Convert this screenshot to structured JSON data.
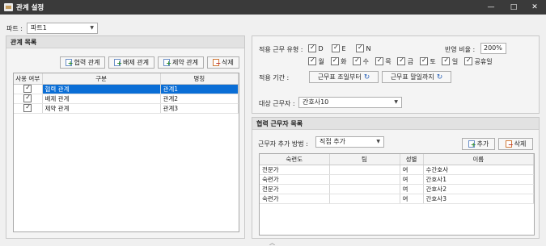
{
  "window": {
    "title": "관계 설정",
    "icon": "app-icon",
    "controls": [
      "minimize-icon",
      "maximize-icon",
      "close-icon"
    ]
  },
  "part": {
    "label": "파트 :",
    "selected": "파트1"
  },
  "relation_panel": {
    "title": "관계 목록",
    "buttons": {
      "cooperate": "협력 관계",
      "exclude": "배제 관계",
      "restrict": "제약 관계",
      "delete": "삭제"
    },
    "columns": [
      "사용 여부",
      "구분",
      "명칭"
    ],
    "rows": [
      {
        "checked": true,
        "kind": "협력 관계",
        "name": "관계1",
        "selected": true
      },
      {
        "checked": true,
        "kind": "배제 관계",
        "name": "관계2",
        "selected": false
      },
      {
        "checked": true,
        "kind": "제약 관계",
        "name": "관계3",
        "selected": false
      }
    ]
  },
  "settings": {
    "work_type_label": "적용 근무 유형 :",
    "work_types": [
      {
        "label": "D",
        "checked": true
      },
      {
        "label": "E",
        "checked": true
      },
      {
        "label": "N",
        "checked": true
      }
    ],
    "ratio_label": "반영 비율 :",
    "ratio_value": "200%",
    "days": [
      {
        "label": "월",
        "checked": true
      },
      {
        "label": "화",
        "checked": true
      },
      {
        "label": "수",
        "checked": true
      },
      {
        "label": "목",
        "checked": true
      },
      {
        "label": "금",
        "checked": true
      },
      {
        "label": "토",
        "checked": true
      },
      {
        "label": "일",
        "checked": true
      },
      {
        "label": "공휴일",
        "checked": true
      }
    ],
    "period_label": "적용 기간 :",
    "period_start": "근무표 조일부터",
    "period_end": "근무표 말일까지",
    "target_label": "대상 근무자 :",
    "target_value": "간호사10"
  },
  "coworker_panel": {
    "title": "협력 근무자 목록",
    "method_label": "근무자 추가 방법 :",
    "method_value": "직접 추가",
    "add_button": "추가",
    "delete_button": "삭제",
    "columns": [
      "숙련도",
      "팀",
      "성별",
      "이름"
    ],
    "rows": [
      {
        "skill": "전문가",
        "team": "",
        "gender": "여",
        "name": "수간호사"
      },
      {
        "skill": "숙련가",
        "team": "",
        "gender": "여",
        "name": "간호사1"
      },
      {
        "skill": "전문가",
        "team": "",
        "gender": "여",
        "name": "간호사2"
      },
      {
        "skill": "숙련가",
        "team": "",
        "gender": "여",
        "name": "간호사3"
      }
    ]
  },
  "footer": {
    "collapse_icon": "chevron-up-icon"
  }
}
